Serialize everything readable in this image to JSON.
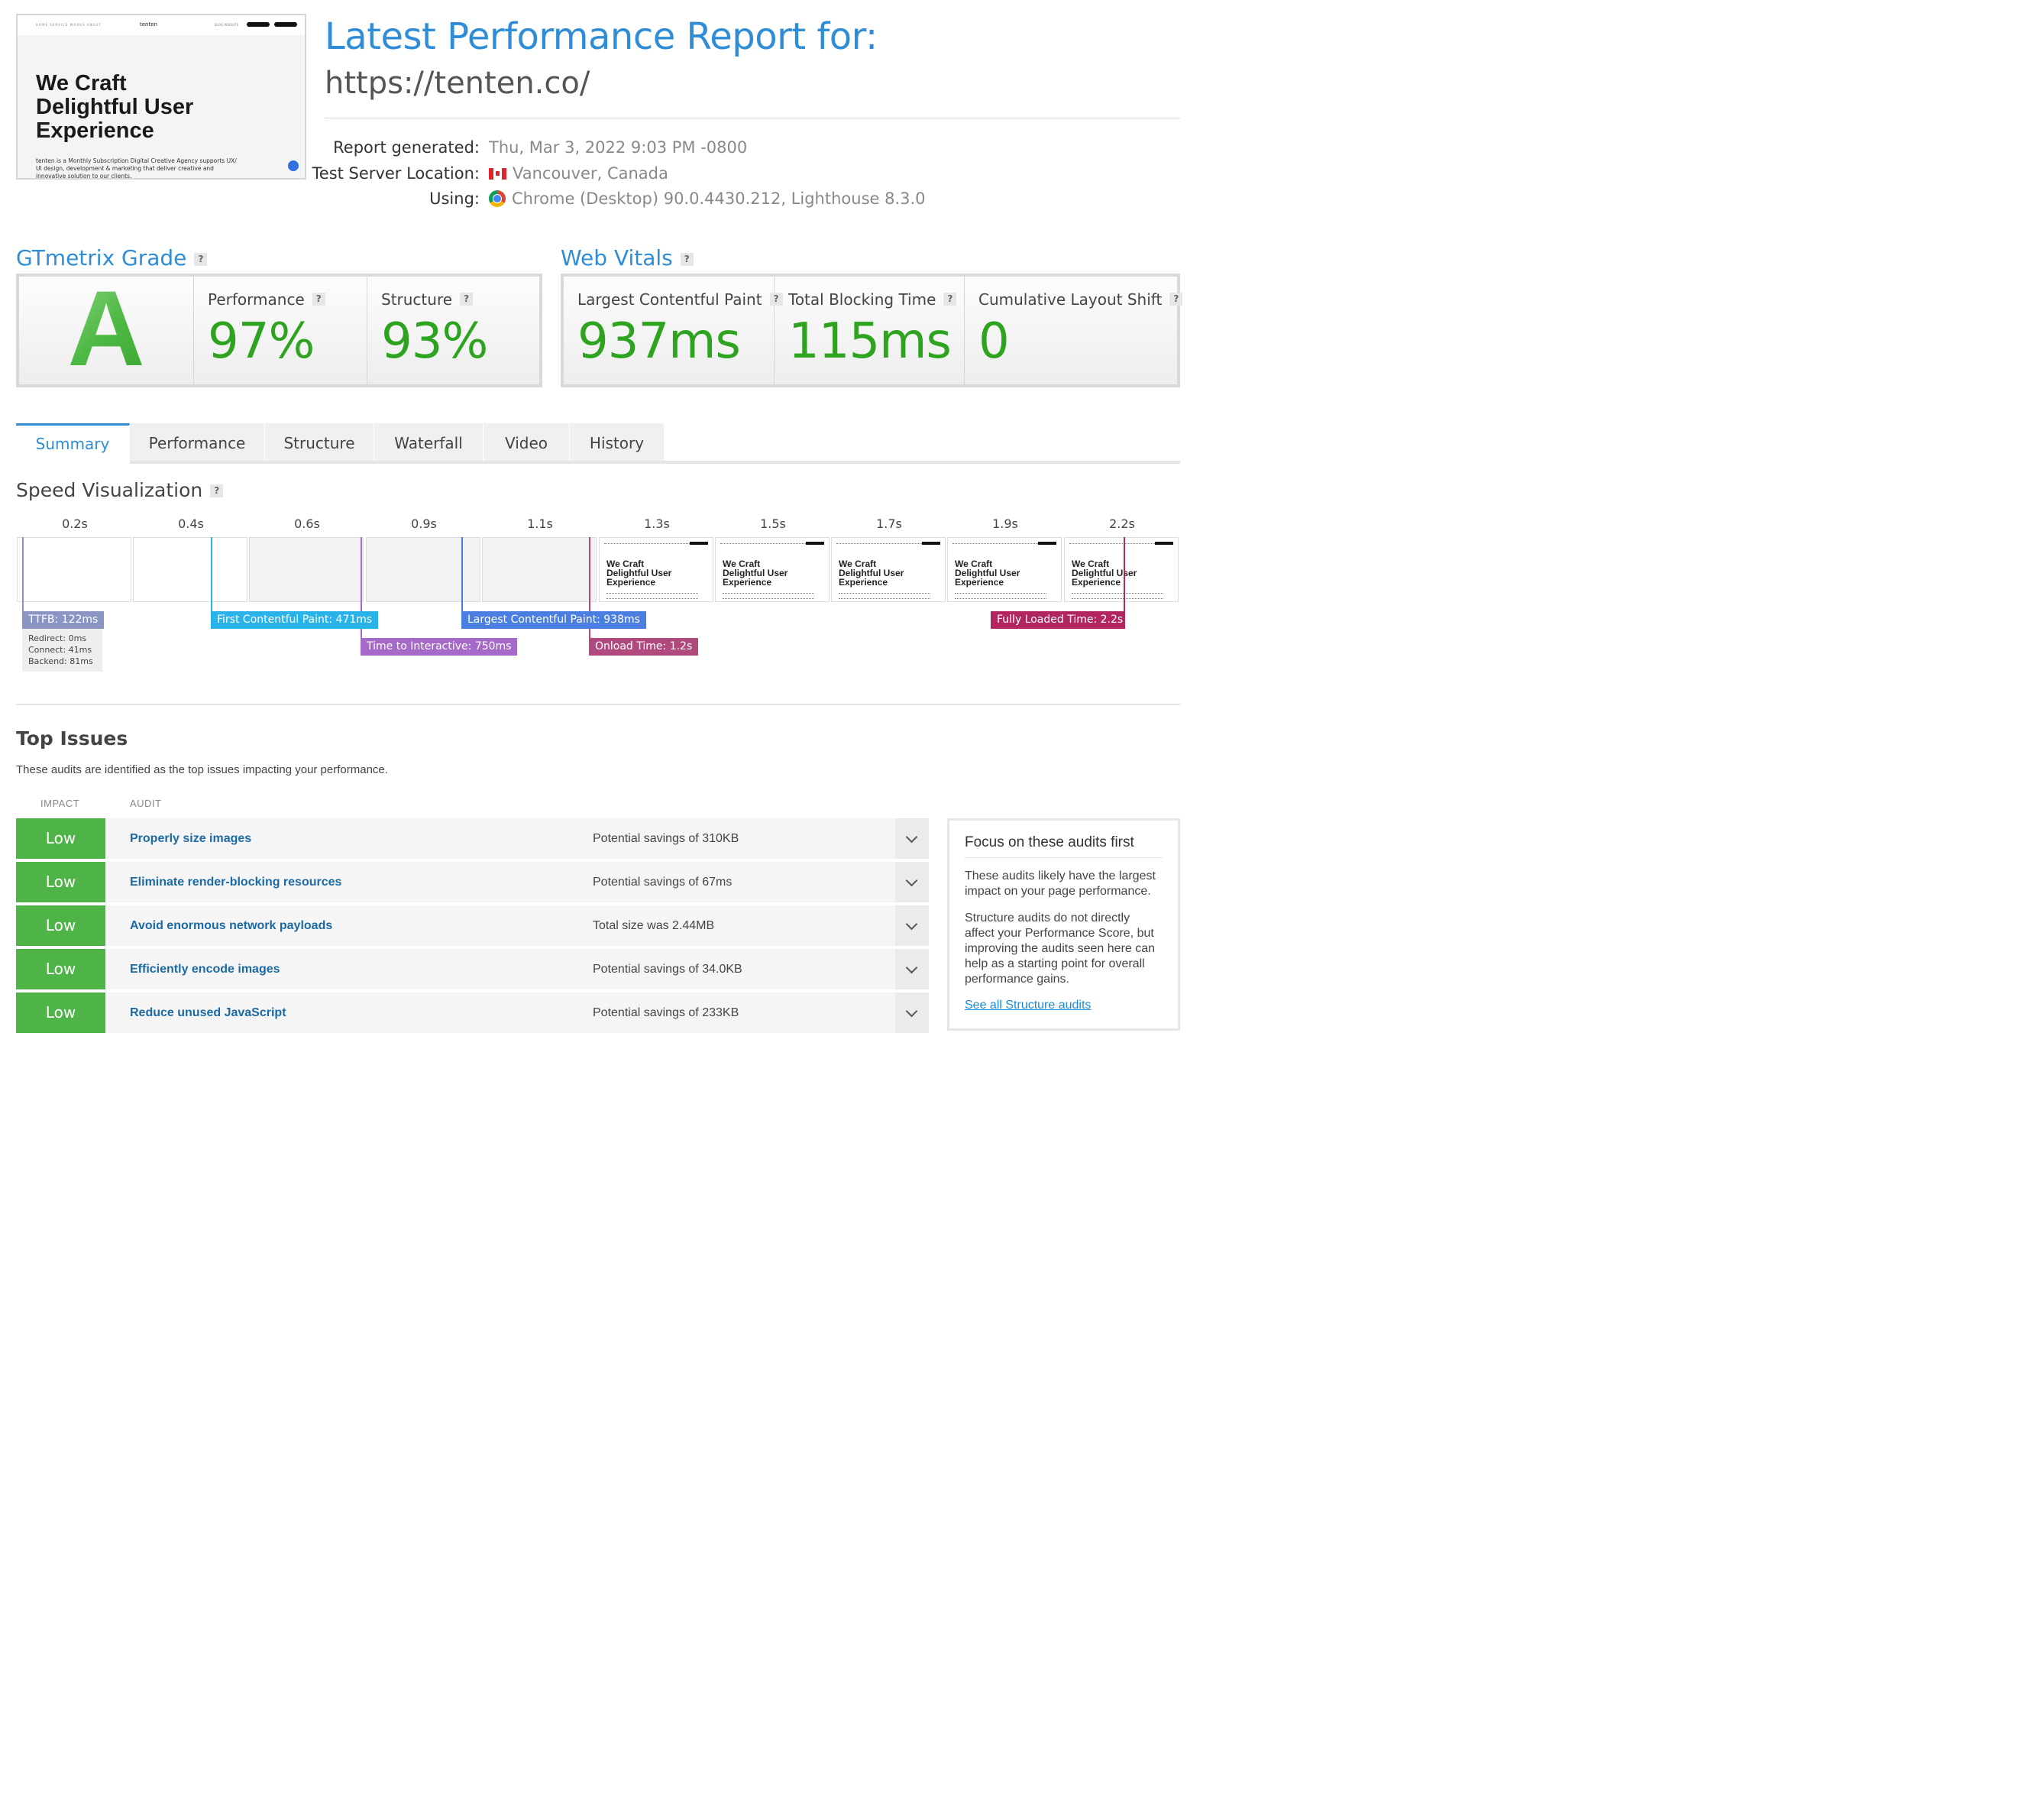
{
  "thumbnail": {
    "nav_left": "HOME   SERVICE   WORKS   ABOUT",
    "logo": "tenten",
    "nav_right": "BLOG   INSIGHTS",
    "hero_lines": [
      "We Craft",
      "Delightful User",
      "Experience"
    ],
    "description": "tenten is a Monthly Subscription Digital Creative Agency supports UX/ UI design, development & marketing that deliver creative and innovative solution to our clients."
  },
  "header": {
    "title": "Latest Performance Report for:",
    "url": "https://tenten.co/"
  },
  "meta": {
    "generated_label": "Report generated:",
    "generated_value": "Thu, Mar 3, 2022 9:03 PM -0800",
    "location_label": "Test Server Location:",
    "location_value": "Vancouver, Canada",
    "using_label": "Using:",
    "using_value": "Chrome (Desktop) 90.0.4430.212, Lighthouse 8.3.0"
  },
  "grade": {
    "title": "GTmetrix Grade",
    "help": "?",
    "letter": "A",
    "performance_label": "Performance",
    "performance_value": "97%",
    "structure_label": "Structure",
    "structure_value": "93%"
  },
  "vitals": {
    "title": "Web Vitals",
    "help": "?",
    "lcp_label": "Largest Contentful Paint",
    "lcp_value": "937ms",
    "tbt_label": "Total Blocking Time",
    "tbt_value": "115ms",
    "cls_label": "Cumulative Layout Shift",
    "cls_value": "0"
  },
  "tabs": [
    "Summary",
    "Performance",
    "Structure",
    "Waterfall",
    "Video",
    "History"
  ],
  "speed": {
    "title": "Speed Visualization",
    "help": "?",
    "ticks": [
      "0.2s",
      "0.4s",
      "0.6s",
      "0.9s",
      "1.1s",
      "1.3s",
      "1.5s",
      "1.7s",
      "1.9s",
      "2.2s"
    ],
    "frame_hero": "We Craft\nDelightful User\nExperience",
    "markers": {
      "ttfb": "TTFB: 122ms",
      "fcp": "First Contentful Paint: 471ms",
      "tti": "Time to Interactive: 750ms",
      "lcp": "Largest Contentful Paint: 938ms",
      "onload": "Onload Time: 1.2s",
      "fully": "Fully Loaded Time: 2.2s"
    },
    "ttfb_detail": [
      "Redirect: 0ms",
      "Connect: 41ms",
      "Backend: 81ms"
    ],
    "colors": {
      "ttfb": "#8a95c4",
      "fcp": "#29b3e8",
      "tti": "#a569c8",
      "lcp": "#4a7ee0",
      "onload": "#b04a7e",
      "fully": "#b2265f"
    }
  },
  "issues": {
    "title": "Top Issues",
    "subtitle": "These audits are identified as the top issues impacting your performance.",
    "col_impact": "IMPACT",
    "col_audit": "AUDIT",
    "rows": [
      {
        "impact": "Low",
        "audit": "Properly size images",
        "detail": "Potential savings of 310KB"
      },
      {
        "impact": "Low",
        "audit": "Eliminate render-blocking resources",
        "detail": "Potential savings of 67ms"
      },
      {
        "impact": "Low",
        "audit": "Avoid enormous network payloads",
        "detail": "Total size was 2.44MB"
      },
      {
        "impact": "Low",
        "audit": "Efficiently encode images",
        "detail": "Potential savings of 34.0KB"
      },
      {
        "impact": "Low",
        "audit": "Reduce unused JavaScript",
        "detail": "Potential savings of 233KB"
      }
    ],
    "focus_title": "Focus on these audits first",
    "focus_p1": "These audits likely have the largest impact on your page performance.",
    "focus_p2": "Structure audits do not directly affect your Performance Score, but improving the audits seen here can help as a starting point for overall performance gains.",
    "focus_link": "See all Structure audits"
  }
}
